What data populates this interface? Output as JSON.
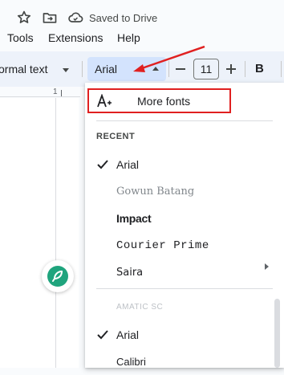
{
  "titlebar": {
    "saved_text": "Saved to Drive"
  },
  "menu": {
    "tools": "Tools",
    "extensions": "Extensions",
    "help": "Help"
  },
  "toolbar": {
    "style_label": "ormal text",
    "font_label": "Arial",
    "font_size": "11",
    "bold_label": "B"
  },
  "ruler": {
    "number": "1"
  },
  "dropdown": {
    "more_fonts_label": "More fonts",
    "recent_header": "RECENT",
    "recent": [
      "Arial",
      "Gowun Batang",
      "Impact",
      "Courier Prime",
      "Saira"
    ],
    "fonts": [
      "AMATIC SC",
      "Arial",
      "Calibri"
    ]
  },
  "colors": {
    "annotation": "#e02020",
    "toolbar_bg": "#edf2fa",
    "selected_bg": "#d3e3fd",
    "badge_green": "#1fa47d"
  },
  "icons": [
    "star-icon",
    "folder-move-icon",
    "cloud-done-icon",
    "add-font-icon",
    "check-icon",
    "chevron-right-icon",
    "minus-icon",
    "plus-icon"
  ]
}
